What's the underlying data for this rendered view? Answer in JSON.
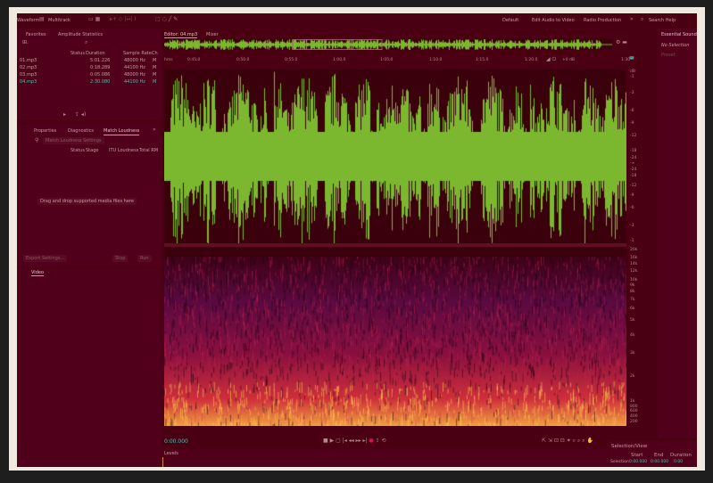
{
  "toolbar": {
    "waveform": "Waveform",
    "multitrack": "Multitrack",
    "workspaces": [
      "Default",
      "Edit Audio to Video",
      "Radio Production"
    ],
    "search": "Search Help"
  },
  "files": {
    "tabs": [
      "Favorites",
      "Amplitude Statistics"
    ],
    "headers": [
      "Status",
      "Duration",
      "Sample Rate",
      "Ch"
    ],
    "rows": [
      {
        "name": "01.mp3",
        "duration": "5:01.226",
        "rate": "48000 Hz",
        "ch": "M"
      },
      {
        "name": "02.mp3",
        "duration": "0:18.289",
        "rate": "44100 Hz",
        "ch": "M"
      },
      {
        "name": "03.mp3",
        "duration": "0:05.086",
        "rate": "48000 Hz",
        "ch": "M"
      },
      {
        "name": "04.mp3",
        "duration": "2:30.080",
        "rate": "44100 Hz",
        "ch": "M"
      }
    ]
  },
  "loudness": {
    "tabs": [
      "Properties",
      "Diagnostics",
      "Match Loudness"
    ],
    "settings": "Match Loudness Settings",
    "headers": [
      "Status",
      "Stage",
      "ITU Loudness",
      "Total RM"
    ],
    "drop": "Drag and drop supported media files here",
    "export": "Export Settings...",
    "stop": "Stop",
    "run": "Run"
  },
  "video": {
    "tab": "Video"
  },
  "editor": {
    "tabs": [
      "Editor: 04.mp3",
      "Mixer"
    ],
    "ruler": [
      "hms",
      "0:45.0",
      "0:50.0",
      "0:55.0",
      "1:00.0",
      "1:05.0",
      "1:10.0",
      "1:15.0",
      "1:20.0",
      "1:30"
    ],
    "gain": "+0 dB",
    "db": [
      "dB",
      "-1",
      "-3",
      "-6",
      "-9",
      "-12",
      "-18",
      "-24",
      "-∞",
      "-24",
      "-18",
      "-12",
      "-9",
      "-6",
      "-3",
      "-1"
    ],
    "freq": [
      "20k",
      "16k",
      "14k",
      "12k",
      "10k",
      "9k",
      "8k",
      "7k",
      "6k",
      "5k",
      "4k",
      "3k",
      "2k",
      "1k",
      "800",
      "600",
      "400",
      "200"
    ],
    "time": "0:00.000",
    "colors": {
      "wave": "#7cb82f",
      "bg": "#4a0012"
    }
  },
  "levels": {
    "title": "Levels"
  },
  "selection": {
    "title": "Selection/View",
    "headers": [
      "Start",
      "End",
      "Duration"
    ],
    "row_label": "Selection",
    "start": "0:00.000",
    "end": "0:00.000",
    "duration": "0:00"
  },
  "essential": {
    "title": "Essential Sound",
    "status": "No Selection",
    "preset": "Preset"
  }
}
